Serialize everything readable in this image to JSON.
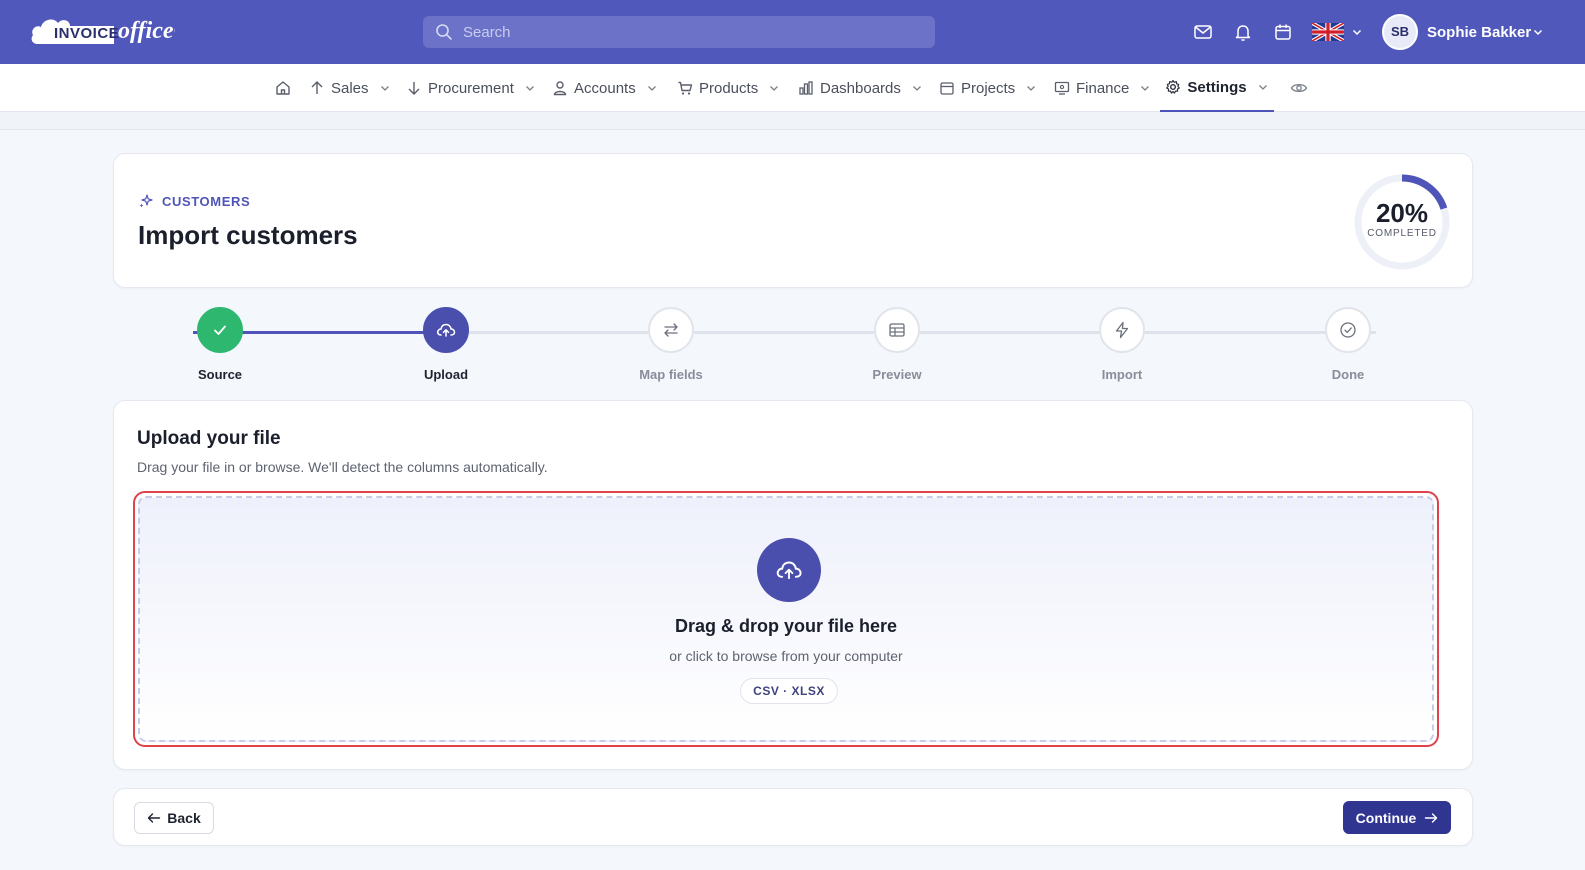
{
  "app": {
    "logo_text_1": "INVOICE",
    "logo_text_2": "office"
  },
  "topbar": {
    "search_placeholder": "Search",
    "icons": [
      "mail-icon",
      "bell-icon",
      "calendar-icon"
    ],
    "language": "English (UK)",
    "user_initials": "SB",
    "user_name": "Sophie Bakker"
  },
  "nav": {
    "items": [
      {
        "label": "Sales",
        "icon": "arrow-up-icon"
      },
      {
        "label": "Procurement",
        "icon": "arrow-down-icon"
      },
      {
        "label": "Accounts",
        "icon": "user-icon"
      },
      {
        "label": "Products",
        "icon": "cart-icon"
      },
      {
        "label": "Dashboards",
        "icon": "bar-chart-icon"
      },
      {
        "label": "Projects",
        "icon": "calendar-icon"
      },
      {
        "label": "Finance",
        "icon": "monitor-icon"
      },
      {
        "label": "Settings",
        "icon": "gear-icon",
        "active": true
      }
    ]
  },
  "header": {
    "eyebrow": "CUSTOMERS",
    "title": "Import customers",
    "progress_value": "20%",
    "progress_fraction": 0.2,
    "progress_label": "COMPLETED"
  },
  "stepper": {
    "steps": [
      {
        "label": "Source",
        "state": "complete"
      },
      {
        "label": "Upload",
        "state": "current"
      },
      {
        "label": "Map fields",
        "state": "pending"
      },
      {
        "label": "Preview",
        "state": "pending"
      },
      {
        "label": "Import",
        "state": "pending"
      },
      {
        "label": "Done",
        "state": "pending"
      }
    ]
  },
  "upload": {
    "title": "Upload your file",
    "subtitle": "Drag your file in or browse. We'll detect the columns automatically.",
    "drop_title": "Drag & drop your file here",
    "drop_subtitle": "or click to browse from your computer",
    "formats": "CSV · XLSX"
  },
  "footer": {
    "back_label": "Back",
    "continue_label": "Continue"
  },
  "colors": {
    "brand": "#5158bb",
    "accent": "#4f55b8",
    "success": "#2eb86f",
    "drop_border": "#e0424c",
    "primary_button": "#303591"
  }
}
